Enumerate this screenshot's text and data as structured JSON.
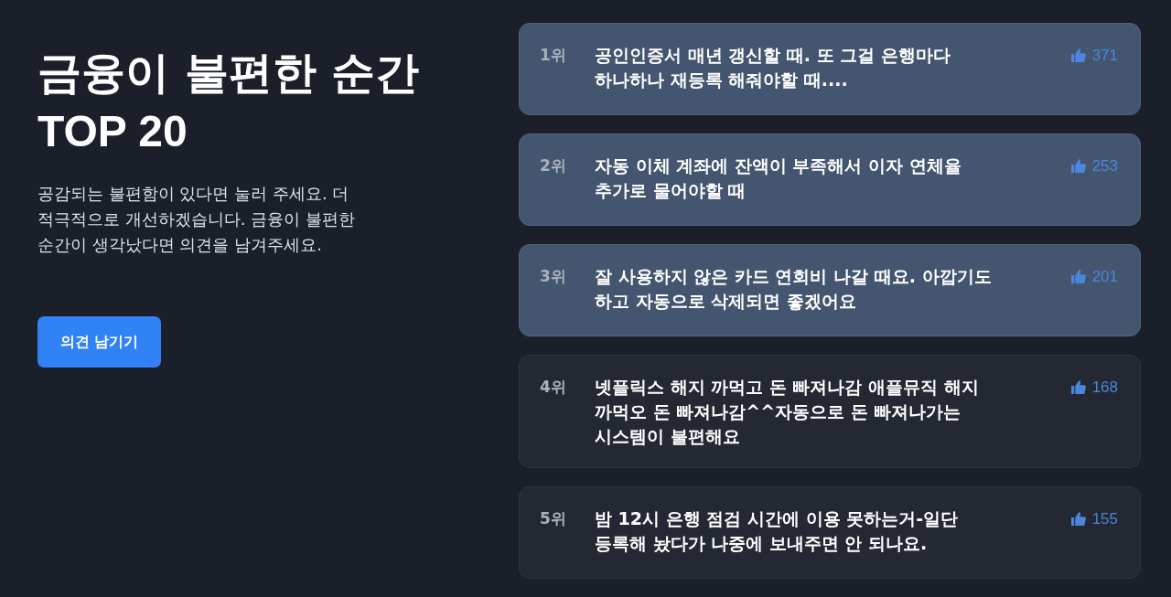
{
  "intro": {
    "title": "금융이 불편한 순간",
    "subtitle": "TOP 20",
    "description": "공감되는 불편함이 있다면 눌러 주세요. 더 적극적으로 개선하겠습니다. 금융이 불편한 순간이 생각났다면 의견을 남겨주세요.",
    "button": "의견 남기기"
  },
  "ranking": [
    {
      "rank": "1위",
      "text": "공인인증서 매년 갱신할 때. 또 그걸 은행마다 하나하나 재등록 해줘야할 때....",
      "likes": "371",
      "highlighted": true
    },
    {
      "rank": "2위",
      "text": "자동 이체 계좌에 잔액이 부족해서 이자 연체율 추가로 물어야할 때",
      "likes": "253",
      "highlighted": true
    },
    {
      "rank": "3위",
      "text": "잘 사용하지 않은 카드 연회비 나갈 때요. 아깝기도 하고 자동으로 삭제되면 좋겠어요",
      "likes": "201",
      "highlighted": true
    },
    {
      "rank": "4위",
      "text": "넷플릭스 해지 까먹고 돈 빠져나감 애플뮤직 해지 까먹오 돈 빠져나감^^자동으로 돈 빠져나가는 시스템이 불편해요",
      "likes": "168",
      "highlighted": false
    },
    {
      "rank": "5위",
      "text": "밤 12시 은행 점검 시간에 이용 못하는거-일단 등록해 놨다가 나중에 보내주면 안 되나요.",
      "likes": "155",
      "highlighted": false
    }
  ]
}
